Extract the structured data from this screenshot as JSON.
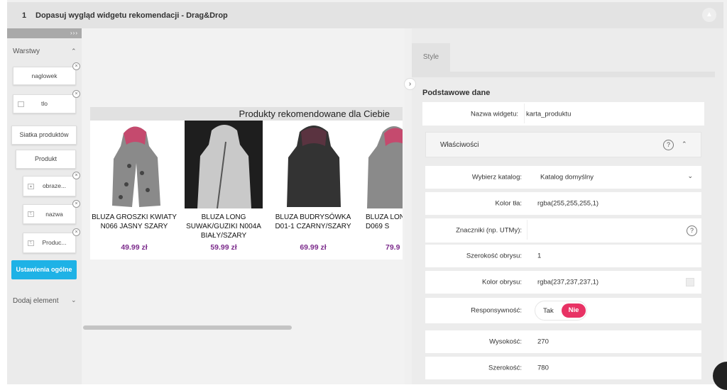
{
  "header": {
    "step": "1",
    "title": "Dopasuj wygląd widgetu rekomendacji - Drag&Drop"
  },
  "sidebar": {
    "expand": "›››",
    "layers_title": "Warstwy",
    "layers": [
      {
        "label": "naglowek"
      },
      {
        "label": "tlo"
      },
      {
        "label": "Siatka produktów"
      },
      {
        "label": "Produkt"
      },
      {
        "label": "obraze..."
      },
      {
        "label": "nazwa"
      },
      {
        "label": "Produc..."
      }
    ],
    "general_button": "Ustawienia ogólne",
    "add_element": "Dodaj element"
  },
  "widget": {
    "header": "Produkty rekomendowane dla Ciebie",
    "products": [
      {
        "name": "BLUZA GROSZKI KWIATY N066 JASNY SZARY",
        "price": "49.99 zł"
      },
      {
        "name": "BLUZA LONG SUWAK/GUZIKI N004A BIAŁY/SZARY",
        "price": "59.99 zł"
      },
      {
        "name": "BLUZA BUDRYSÓWKA D01-1 CZARNY/SZARY",
        "price": "69.99 zł"
      },
      {
        "name": "BLUZA LON D069 S",
        "price": "79.9"
      }
    ]
  },
  "panel": {
    "tab": "Style",
    "section": "Podstawowe dane",
    "widget_name_label": "Nazwa widgetu:",
    "widget_name_value": "karta_produktu",
    "props_title": "Właściwości",
    "fields": {
      "catalog_label": "Wybierz katalog:",
      "catalog_value": "Katalog domyślny",
      "bg_label": "Kolor tła:",
      "bg_value": "rgba(255,255,255,1)",
      "utm_label": "Znaczniki (np. UTMy):",
      "utm_value": "",
      "border_w_label": "Szerokość obrysu:",
      "border_w_value": "1",
      "border_c_label": "Kolor obrysu:",
      "border_c_value": "rgba(237,237,237,1)",
      "responsive_label": "Responsywność:",
      "responsive_yes": "Tak",
      "responsive_no": "Nie",
      "height_label": "Wysokość:",
      "height_value": "270",
      "width_label": "Szerokość:",
      "width_value": "780"
    }
  },
  "colors": {
    "accent_blue": "#1eb2e6",
    "accent_pink": "#e83264",
    "price": "#7b2a8b"
  },
  "icons": [
    "close-icon",
    "image-icon",
    "text-icon",
    "chevron-up-icon",
    "chevron-down-icon",
    "help-icon",
    "chevron-right-icon"
  ]
}
